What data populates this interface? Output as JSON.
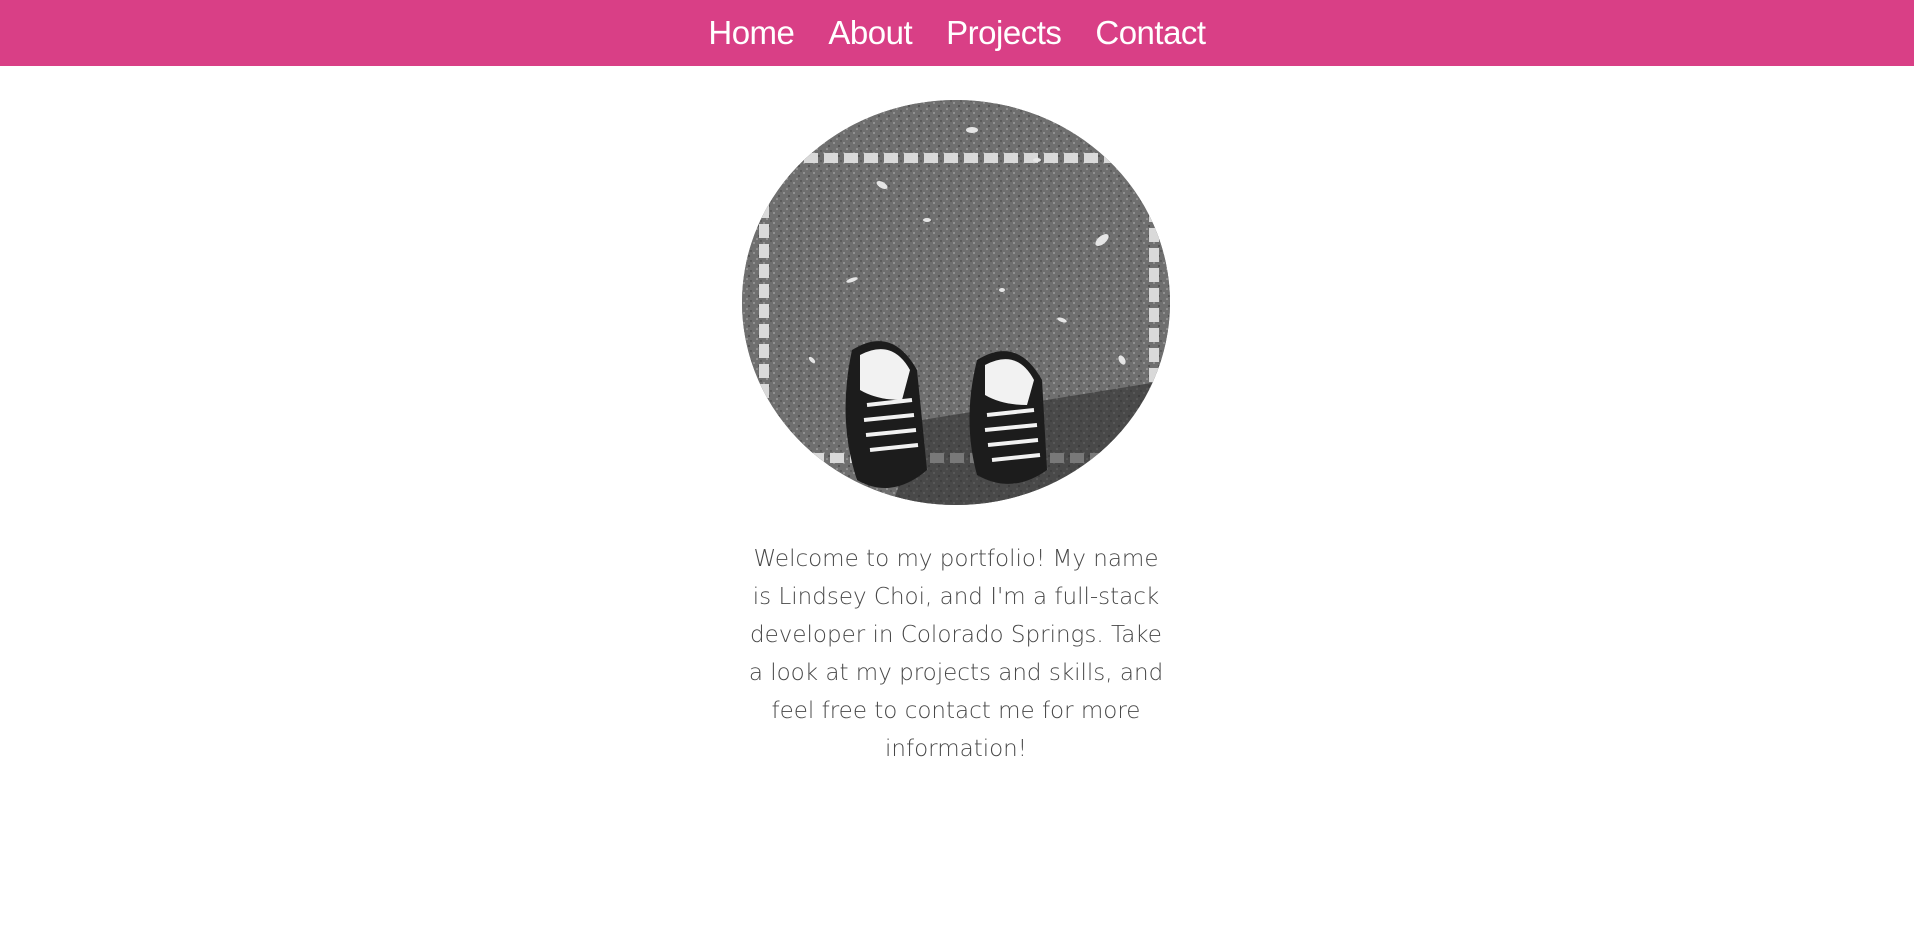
{
  "nav": {
    "items": [
      {
        "label": "Home"
      },
      {
        "label": "About"
      },
      {
        "label": "Projects"
      },
      {
        "label": "Contact"
      }
    ]
  },
  "hero": {
    "image_description_icon": "profile-photo-sneakers",
    "intro_text": "Welcome to my portfolio! My name is Lindsey Choi, and I'm a full-stack developer in Colorado Springs. Take a look at my projects and skills, and feel free to contact me for more information!"
  },
  "colors": {
    "nav_background": "#d93f86",
    "nav_text": "#ffffff",
    "body_text": "#484848",
    "page_background": "#ffffff"
  }
}
